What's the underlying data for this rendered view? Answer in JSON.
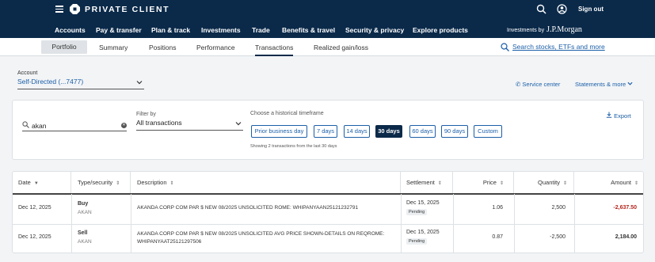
{
  "header": {
    "brand": "PRIVATE CLIENT",
    "sign_out": "Sign out",
    "nav": [
      "Accounts",
      "Pay & transfer",
      "Plan & track",
      "Investments",
      "Trade",
      "Benefits & travel",
      "Security & privacy",
      "Explore products"
    ],
    "active_nav": "Investments",
    "investments_by_prefix": "Investments by",
    "investments_by_brand": "J.P.Morgan"
  },
  "subnav": {
    "tabs": [
      "Portfolio",
      "Summary",
      "Positions",
      "Performance",
      "Transactions",
      "Realized gain/loss"
    ],
    "active_tab": "Transactions",
    "search_link": "Search stocks, ETFs and more"
  },
  "account": {
    "label": "Account",
    "value": "Self-Directed (...7477)",
    "service_center": "Service center",
    "statements": "Statements & more"
  },
  "filters": {
    "search_value": "akan",
    "filter_label": "Filter by",
    "filter_value": "All transactions",
    "timeframe_label": "Choose a historical timeframe",
    "timeframes": [
      "Prior business day",
      "7 days",
      "14 days",
      "30 days",
      "60 days",
      "90 days",
      "Custom"
    ],
    "selected_timeframe": "30 days",
    "showing": "Showing 2 transactions from the last 30 days",
    "export": "Export"
  },
  "table": {
    "headers": [
      "Date",
      "Type/security",
      "Description",
      "Settlement",
      "Price",
      "Quantity",
      "Amount"
    ],
    "rows": [
      {
        "date": "Dec 12, 2025",
        "type": "Buy",
        "security": "AKAN",
        "desc1": "AKANDA CORP COM PAR $ NEW 08/2025 UNSOLICITED ROME: WHIPANYAAN25121232791",
        "desc2": "",
        "settlement": "Dec 15, 2025",
        "status": "Pending",
        "price": "1.06",
        "quantity": "2,500",
        "amount": "-2,637.50"
      },
      {
        "date": "Dec 12, 2025",
        "type": "Sell",
        "security": "AKAN",
        "desc1": "AKANDA CORP COM PAR $ NEW 08/2025 UNSOLICITED AVG PRICE SHOWN-DETAILS ON REQROME:",
        "desc2": "WHIPANYAAT25121297506",
        "settlement": "Dec 15, 2025",
        "status": "Pending",
        "price": "0.87",
        "quantity": "-2,500",
        "amount": "2,184.00"
      }
    ]
  },
  "colors": {
    "navy": "#0b2a4a",
    "link": "#1c5fa8",
    "negative": "#b3261e"
  }
}
